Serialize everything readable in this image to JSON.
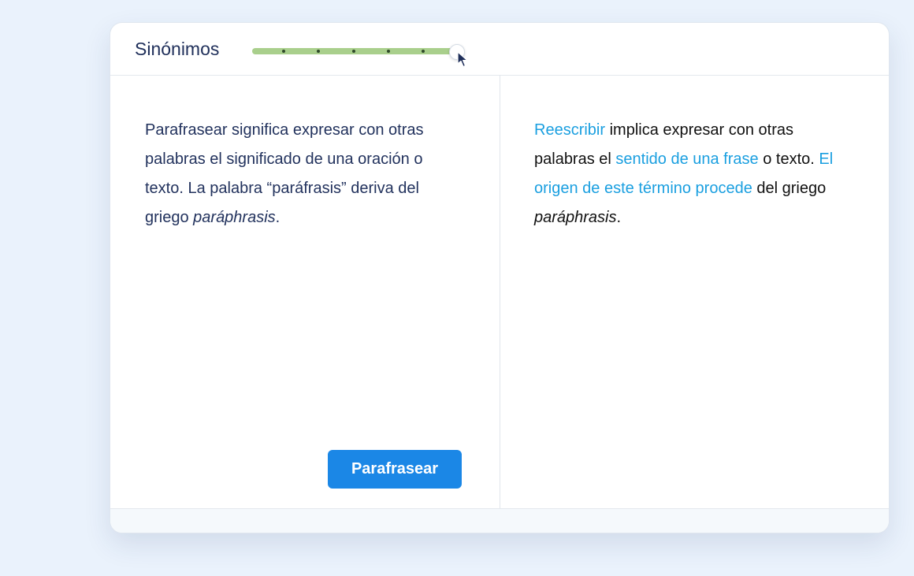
{
  "header": {
    "mode_label": "Sinónimos",
    "synonyms_level_percent": 100
  },
  "input_panel": {
    "p1": "Parafrasear significa expresar con otras palabras el significado de una oración o texto. La palabra “paráfrasis” deriva del griego ",
    "italic_word": "paráphrasis",
    "end": "."
  },
  "output_panel": {
    "changed_1": "Reescribir",
    "plain_1": " implica expresar con otras palabras el ",
    "changed_2": "sentido de una frase",
    "plain_2": " o texto. ",
    "changed_3": "El origen de este término procede",
    "plain_3": " del griego ",
    "italic_word": "paráphrasis",
    "end": "."
  },
  "actions": {
    "paraphrase_label": "Parafrasear"
  },
  "colors": {
    "background": "#eaf2fc",
    "slider_track": "#a9cf8c",
    "changed_text": "#1a9fe0",
    "button": "#1b87e6",
    "input_text": "#22325d"
  },
  "icons": {
    "cursor": "cursor-arrow-icon"
  }
}
